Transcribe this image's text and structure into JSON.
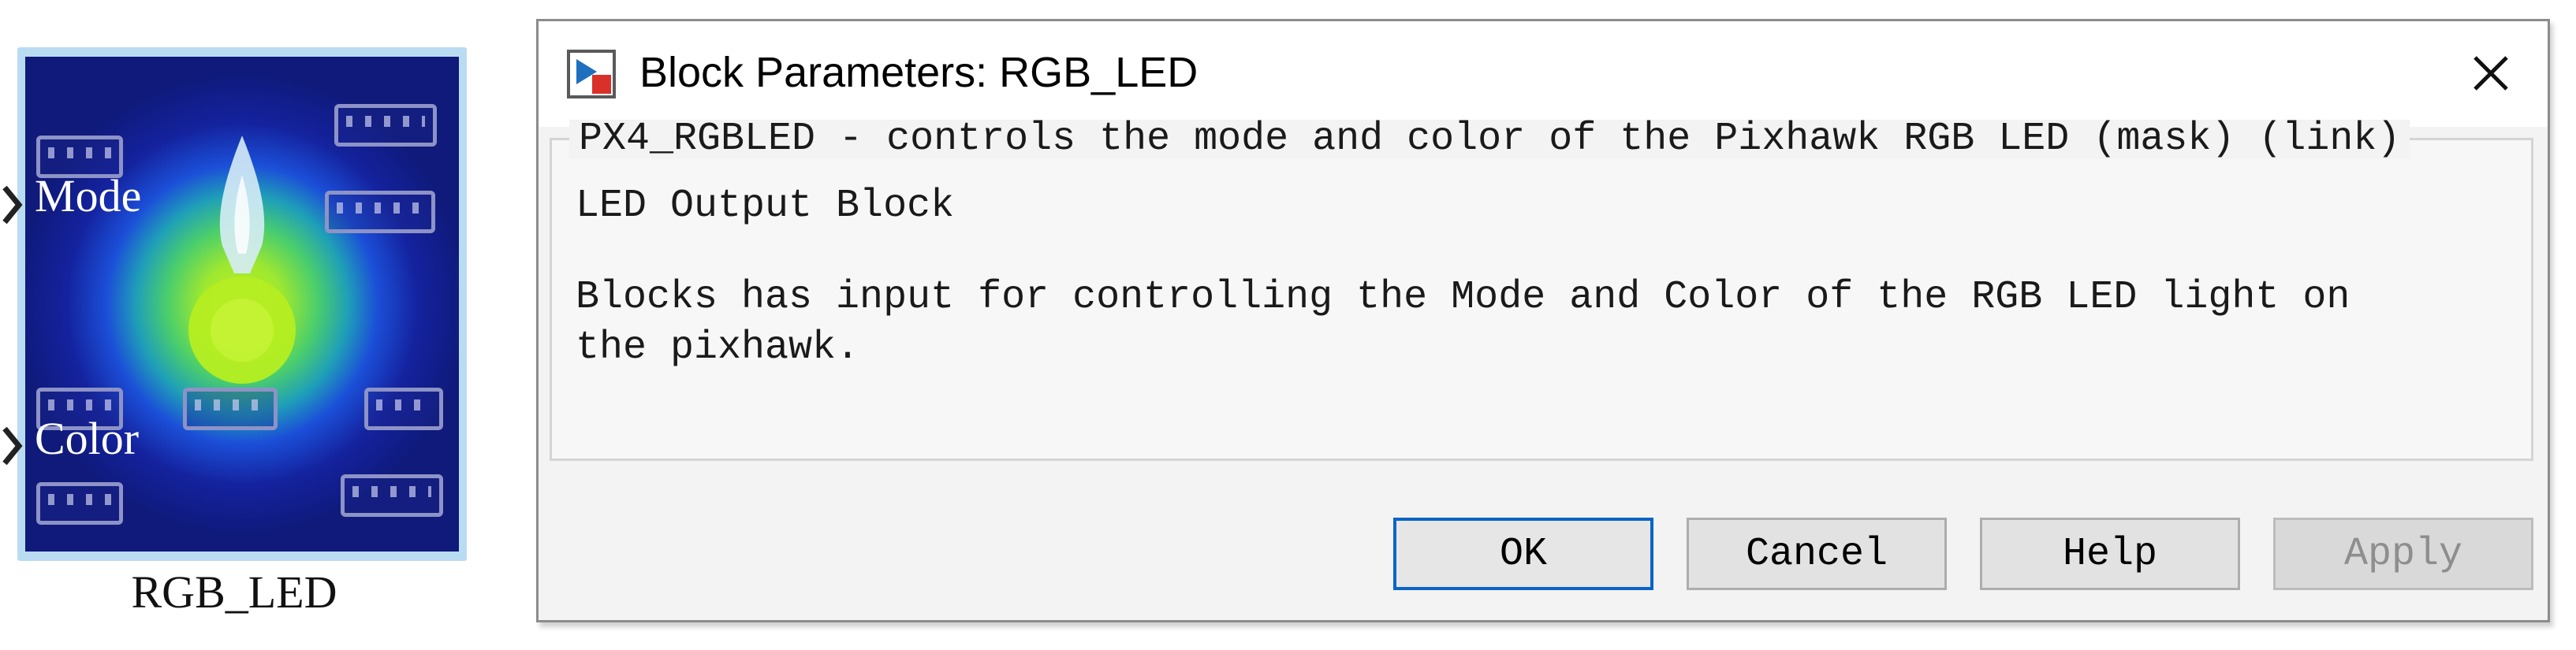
{
  "block": {
    "name": "RGB_LED",
    "ports": [
      {
        "label": "Mode"
      },
      {
        "label": "Color"
      }
    ],
    "colors": {
      "frame": "#b9dcf3",
      "glow": "#b8ee2c",
      "board": "#14229e"
    }
  },
  "dialog": {
    "title": "Block Parameters: RGB_LED",
    "icons": {
      "app": "simulink-block-icon",
      "close": "close-icon"
    },
    "group_legend": "PX4_RGBLED - controls the mode and color of the Pixhawk RGB LED (mask) (link)",
    "heading": "LED Output Block",
    "description_line1": "Blocks has input for controlling the Mode and Color of the RGB LED light on",
    "description_line2": "the pixhawk.",
    "buttons": {
      "ok": "OK",
      "cancel": "Cancel",
      "help": "Help",
      "apply": "Apply"
    },
    "colors": {
      "default_button_border": "#0a64c8",
      "disabled_text": "#8e8e8e"
    }
  }
}
